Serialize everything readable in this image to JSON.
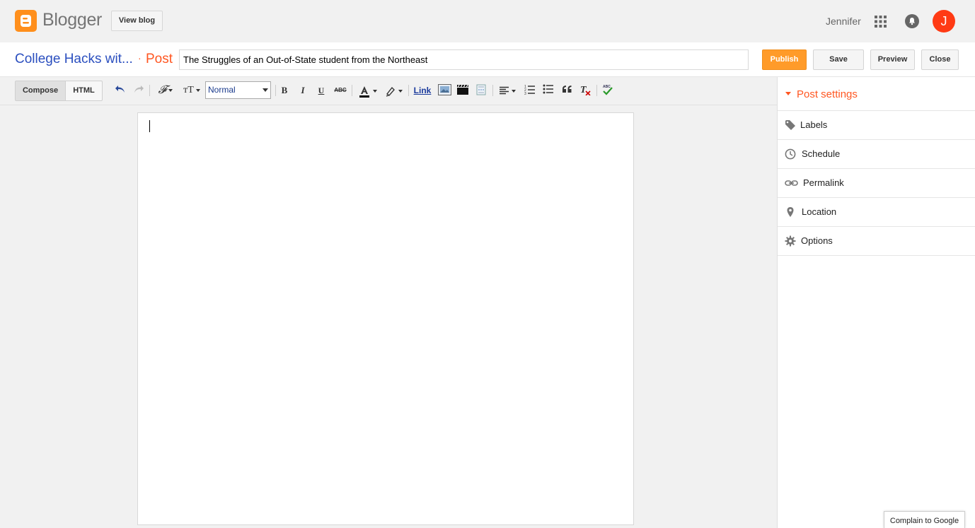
{
  "header": {
    "brand": "Blogger",
    "view_blog_label": "View blog",
    "username": "Jennifer",
    "avatar_initial": "J",
    "brand_color": "#ff8f1c",
    "avatar_color": "#ff3a14"
  },
  "titlebar": {
    "blog_name": "College Hacks wit...",
    "separator": "·",
    "post_type": "Post",
    "post_title_value": "The Struggles of an Out-of-State student from the Northeast",
    "buttons": {
      "publish": "Publish",
      "save": "Save",
      "preview": "Preview",
      "close": "Close"
    },
    "publish_color": "#ff9b29"
  },
  "toolbar": {
    "compose_label": "Compose",
    "html_label": "HTML",
    "format_value": "Normal",
    "bold": "B",
    "italic": "I",
    "underline": "U",
    "strike": "ABC",
    "link": "Link",
    "icons": [
      "undo-icon",
      "redo-icon",
      "font-family-icon",
      "font-size-icon",
      "text-color-icon",
      "highlight-icon",
      "image-icon",
      "video-icon",
      "jump-break-icon",
      "align-icon",
      "numbered-list-icon",
      "bullet-list-icon",
      "quote-icon",
      "clear-format-icon",
      "spellcheck-icon"
    ]
  },
  "editor": {
    "content": ""
  },
  "sidebar": {
    "title": "Post settings",
    "items": [
      {
        "label": "Labels",
        "icon": "tag-icon"
      },
      {
        "label": "Schedule",
        "icon": "clock-icon"
      },
      {
        "label": "Permalink",
        "icon": "link-icon"
      },
      {
        "label": "Location",
        "icon": "pin-icon"
      },
      {
        "label": "Options",
        "icon": "gear-icon"
      }
    ],
    "accent_color": "#ff5722"
  },
  "footer": {
    "complain_label": "Complain to Google"
  }
}
